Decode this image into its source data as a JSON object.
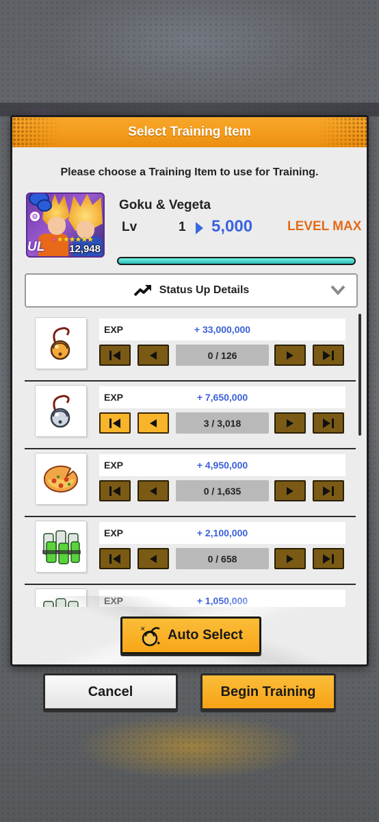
{
  "dialog": {
    "title": "Select Training Item",
    "instruction": "Please choose a Training Item to use for Training."
  },
  "character": {
    "name": "Goku & Vegeta",
    "lv_label": "Lv",
    "level_current": "1",
    "level_target": "5,000",
    "level_status": "LEVEL MAX",
    "badge": "UL",
    "power": "12,948",
    "rank_icon": "rank-badge-icon",
    "exp_fill": 1.0,
    "colors": {
      "target": "#3a63e0",
      "level_max": "#e46a18",
      "bar": "#2bbdb6"
    }
  },
  "status_details": {
    "label": "Status Up Details"
  },
  "items": [
    {
      "icon": "gold-bell-icon",
      "label": "EXP",
      "value": "+ 33,000,000",
      "count": "0 / 126",
      "active_left": false
    },
    {
      "icon": "silver-bell-icon",
      "label": "EXP",
      "value": "+ 7,650,000",
      "count": "3 / 3,018",
      "active_left": true
    },
    {
      "icon": "pizza-icon",
      "label": "EXP",
      "value": "+ 4,950,000",
      "count": "0 / 1,635",
      "active_left": false
    },
    {
      "icon": "energy-drink-pack-icon",
      "label": "EXP",
      "value": "+ 2,100,000",
      "count": "0 / 658",
      "active_left": false
    },
    {
      "icon": "energy-drink-pack-icon",
      "label": "EXP",
      "value": "+ 1,050,000",
      "count": "",
      "active_left": false
    }
  ],
  "buttons": {
    "auto_select": "Auto Select",
    "cancel": "Cancel",
    "begin_training": "Begin Training"
  }
}
